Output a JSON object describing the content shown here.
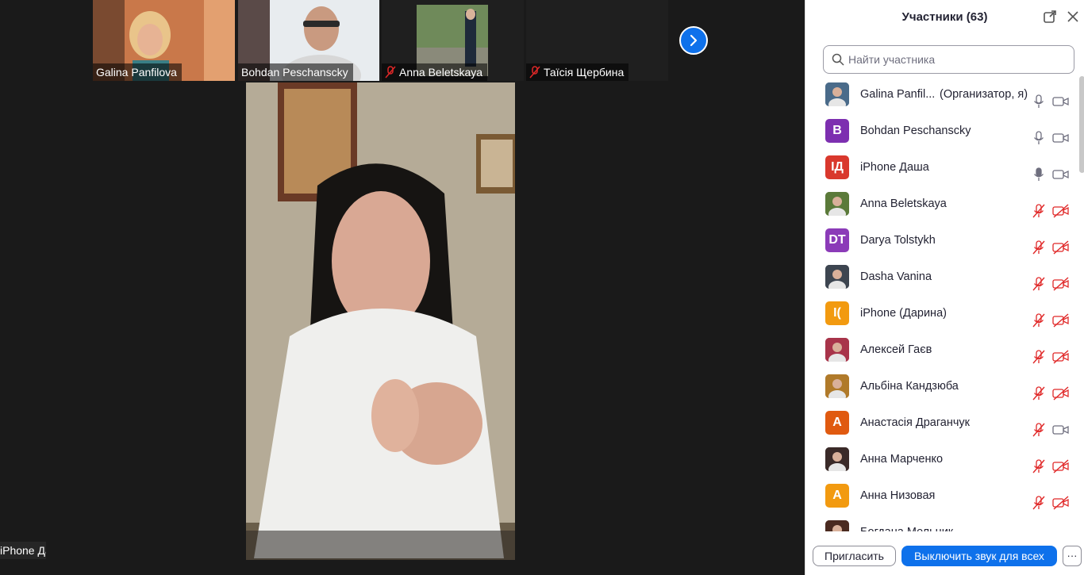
{
  "video": {
    "thumbnails": [
      {
        "name": "Galina Panfilova",
        "muted": false
      },
      {
        "name": "Bohdan Peschanscky",
        "muted": false
      },
      {
        "name": "Anna Beletskaya",
        "muted": true
      },
      {
        "name": "Таїсія Щербина",
        "muted": true
      }
    ],
    "speaker_label": "iPhone Даша"
  },
  "panel": {
    "title": "Участники (63)",
    "search_placeholder": "Найти участника",
    "participants": [
      {
        "name": "Galina Panfil...",
        "role": "(Организатор, я)",
        "avatar_text": "",
        "avatar_color": "#4a6b8a",
        "mic": "on",
        "cam": "on"
      },
      {
        "name": "Bohdan Peschanscky",
        "role": "",
        "avatar_text": "B",
        "avatar_color": "#7d2fb0",
        "mic": "on",
        "cam": "on"
      },
      {
        "name": "iPhone Даша",
        "role": "",
        "avatar_text": "IД",
        "avatar_color": "#d9382d",
        "mic": "active",
        "cam": "on"
      },
      {
        "name": "Anna Beletskaya",
        "role": "",
        "avatar_text": "",
        "avatar_color": "#5b7a3a",
        "mic": "off",
        "cam": "off"
      },
      {
        "name": "Darya Tolstykh",
        "role": "",
        "avatar_text": "DT",
        "avatar_color": "#8b3bb8",
        "mic": "off",
        "cam": "off"
      },
      {
        "name": "Dasha Vanina",
        "role": "",
        "avatar_text": "",
        "avatar_color": "#3d4550",
        "mic": "off",
        "cam": "off"
      },
      {
        "name": "iPhone (Дарина)",
        "role": "",
        "avatar_text": "I(",
        "avatar_color": "#f29a10",
        "mic": "off",
        "cam": "off"
      },
      {
        "name": "Алексей Гаєв",
        "role": "",
        "avatar_text": "",
        "avatar_color": "#a8344a",
        "mic": "off",
        "cam": "off"
      },
      {
        "name": "Альбіна Кандзюба",
        "role": "",
        "avatar_text": "",
        "avatar_color": "#b07a2a",
        "mic": "off",
        "cam": "off"
      },
      {
        "name": "Анастасія Драганчук",
        "role": "",
        "avatar_text": "A",
        "avatar_color": "#e05a10",
        "mic": "off",
        "cam": "on"
      },
      {
        "name": "Анна Марченко",
        "role": "",
        "avatar_text": "",
        "avatar_color": "#3a2a28",
        "mic": "off",
        "cam": "off"
      },
      {
        "name": "Анна Низовая",
        "role": "",
        "avatar_text": "A",
        "avatar_color": "#f29a10",
        "mic": "off",
        "cam": "off"
      },
      {
        "name": "Богдана Мельник",
        "role": "",
        "avatar_text": "",
        "avatar_color": "#4a2a20",
        "mic": "off",
        "cam": "off"
      }
    ],
    "invite_label": "Пригласить",
    "mute_all_label": "Выключить звук для всех",
    "more_label": "···"
  }
}
